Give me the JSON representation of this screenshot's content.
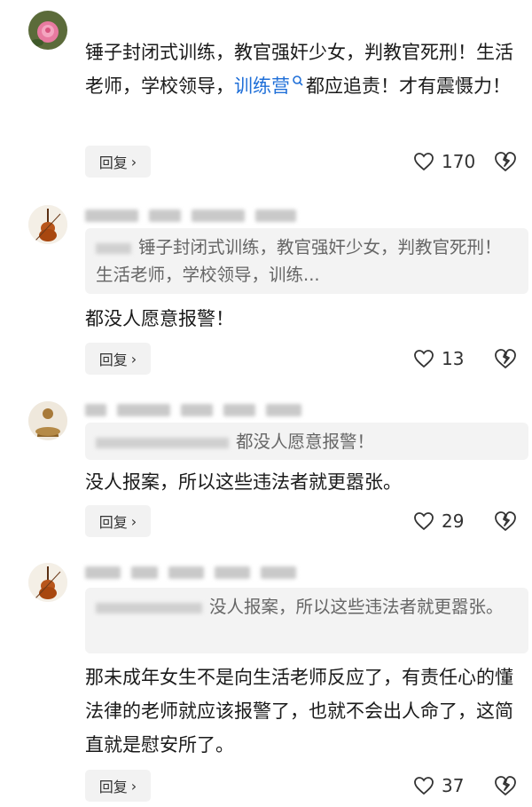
{
  "comments": [
    {
      "text_before": "锤子封闭式训练，教官强奸少女，判教官死刑！生活老师，学校领导，",
      "link": "训练营",
      "text_after": "都应追责！才有震慑力！",
      "reply_label": "回复",
      "likes": "170"
    },
    {
      "quote": "锤子封闭式训练，教官强奸少女，判教官死刑！生活老师，学校领导，训练...",
      "text": "都没人愿意报警！",
      "reply_label": "回复",
      "likes": "13"
    },
    {
      "quote": "都没人愿意报警！",
      "text": "没人报案，所以这些违法者就更嚣张。",
      "reply_label": "回复",
      "likes": "29"
    },
    {
      "quote": "没人报案，所以这些违法者就更嚣张。",
      "text": "那未成年女生不是向生活老师反应了，有责任心的懂法律的老师就应该报警了，也就不会出人命了，这简直就是慰安所了。",
      "reply_label": "回复",
      "likes": "37"
    }
  ],
  "icons": {
    "like": "heart-outline-icon",
    "dislike": "broken-heart-icon",
    "reply": "chevron-right-icon",
    "link_search": "search-icon"
  }
}
